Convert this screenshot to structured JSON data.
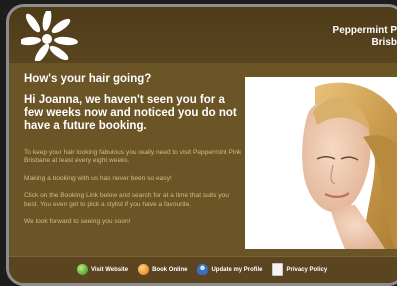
{
  "brand": {
    "line1": "Peppermint P",
    "line2": "Brisb"
  },
  "main": {
    "heading": "How's your hair going?",
    "subheading": "Hi Joanna, we haven't seen you for a few weeks now and noticed you do not have a future booking.",
    "paragraphs": [
      "To keep your hair looking fabulous you really need to visit Peppermint Pink Brisbane at least every eight weeks.",
      "Making a booking with us has never been so easy!",
      "Click on the Booking Link below and search for at a time that suits you best.  You even get to pick a stylist if you have a favourite.",
      "We look forward to seeing you soon!"
    ]
  },
  "footer": {
    "links": [
      {
        "label": "Visit Website",
        "icon": "globe-icon"
      },
      {
        "label": "Book Online",
        "icon": "book-icon"
      },
      {
        "label": "Update my Profile",
        "icon": "profile-icon"
      },
      {
        "label": "Privacy Policy",
        "icon": "document-icon"
      }
    ]
  },
  "colors": {
    "background": "#6b5527",
    "header": "#4e3b18",
    "text": "#ffffff",
    "muted_text": "#cfbd86"
  }
}
